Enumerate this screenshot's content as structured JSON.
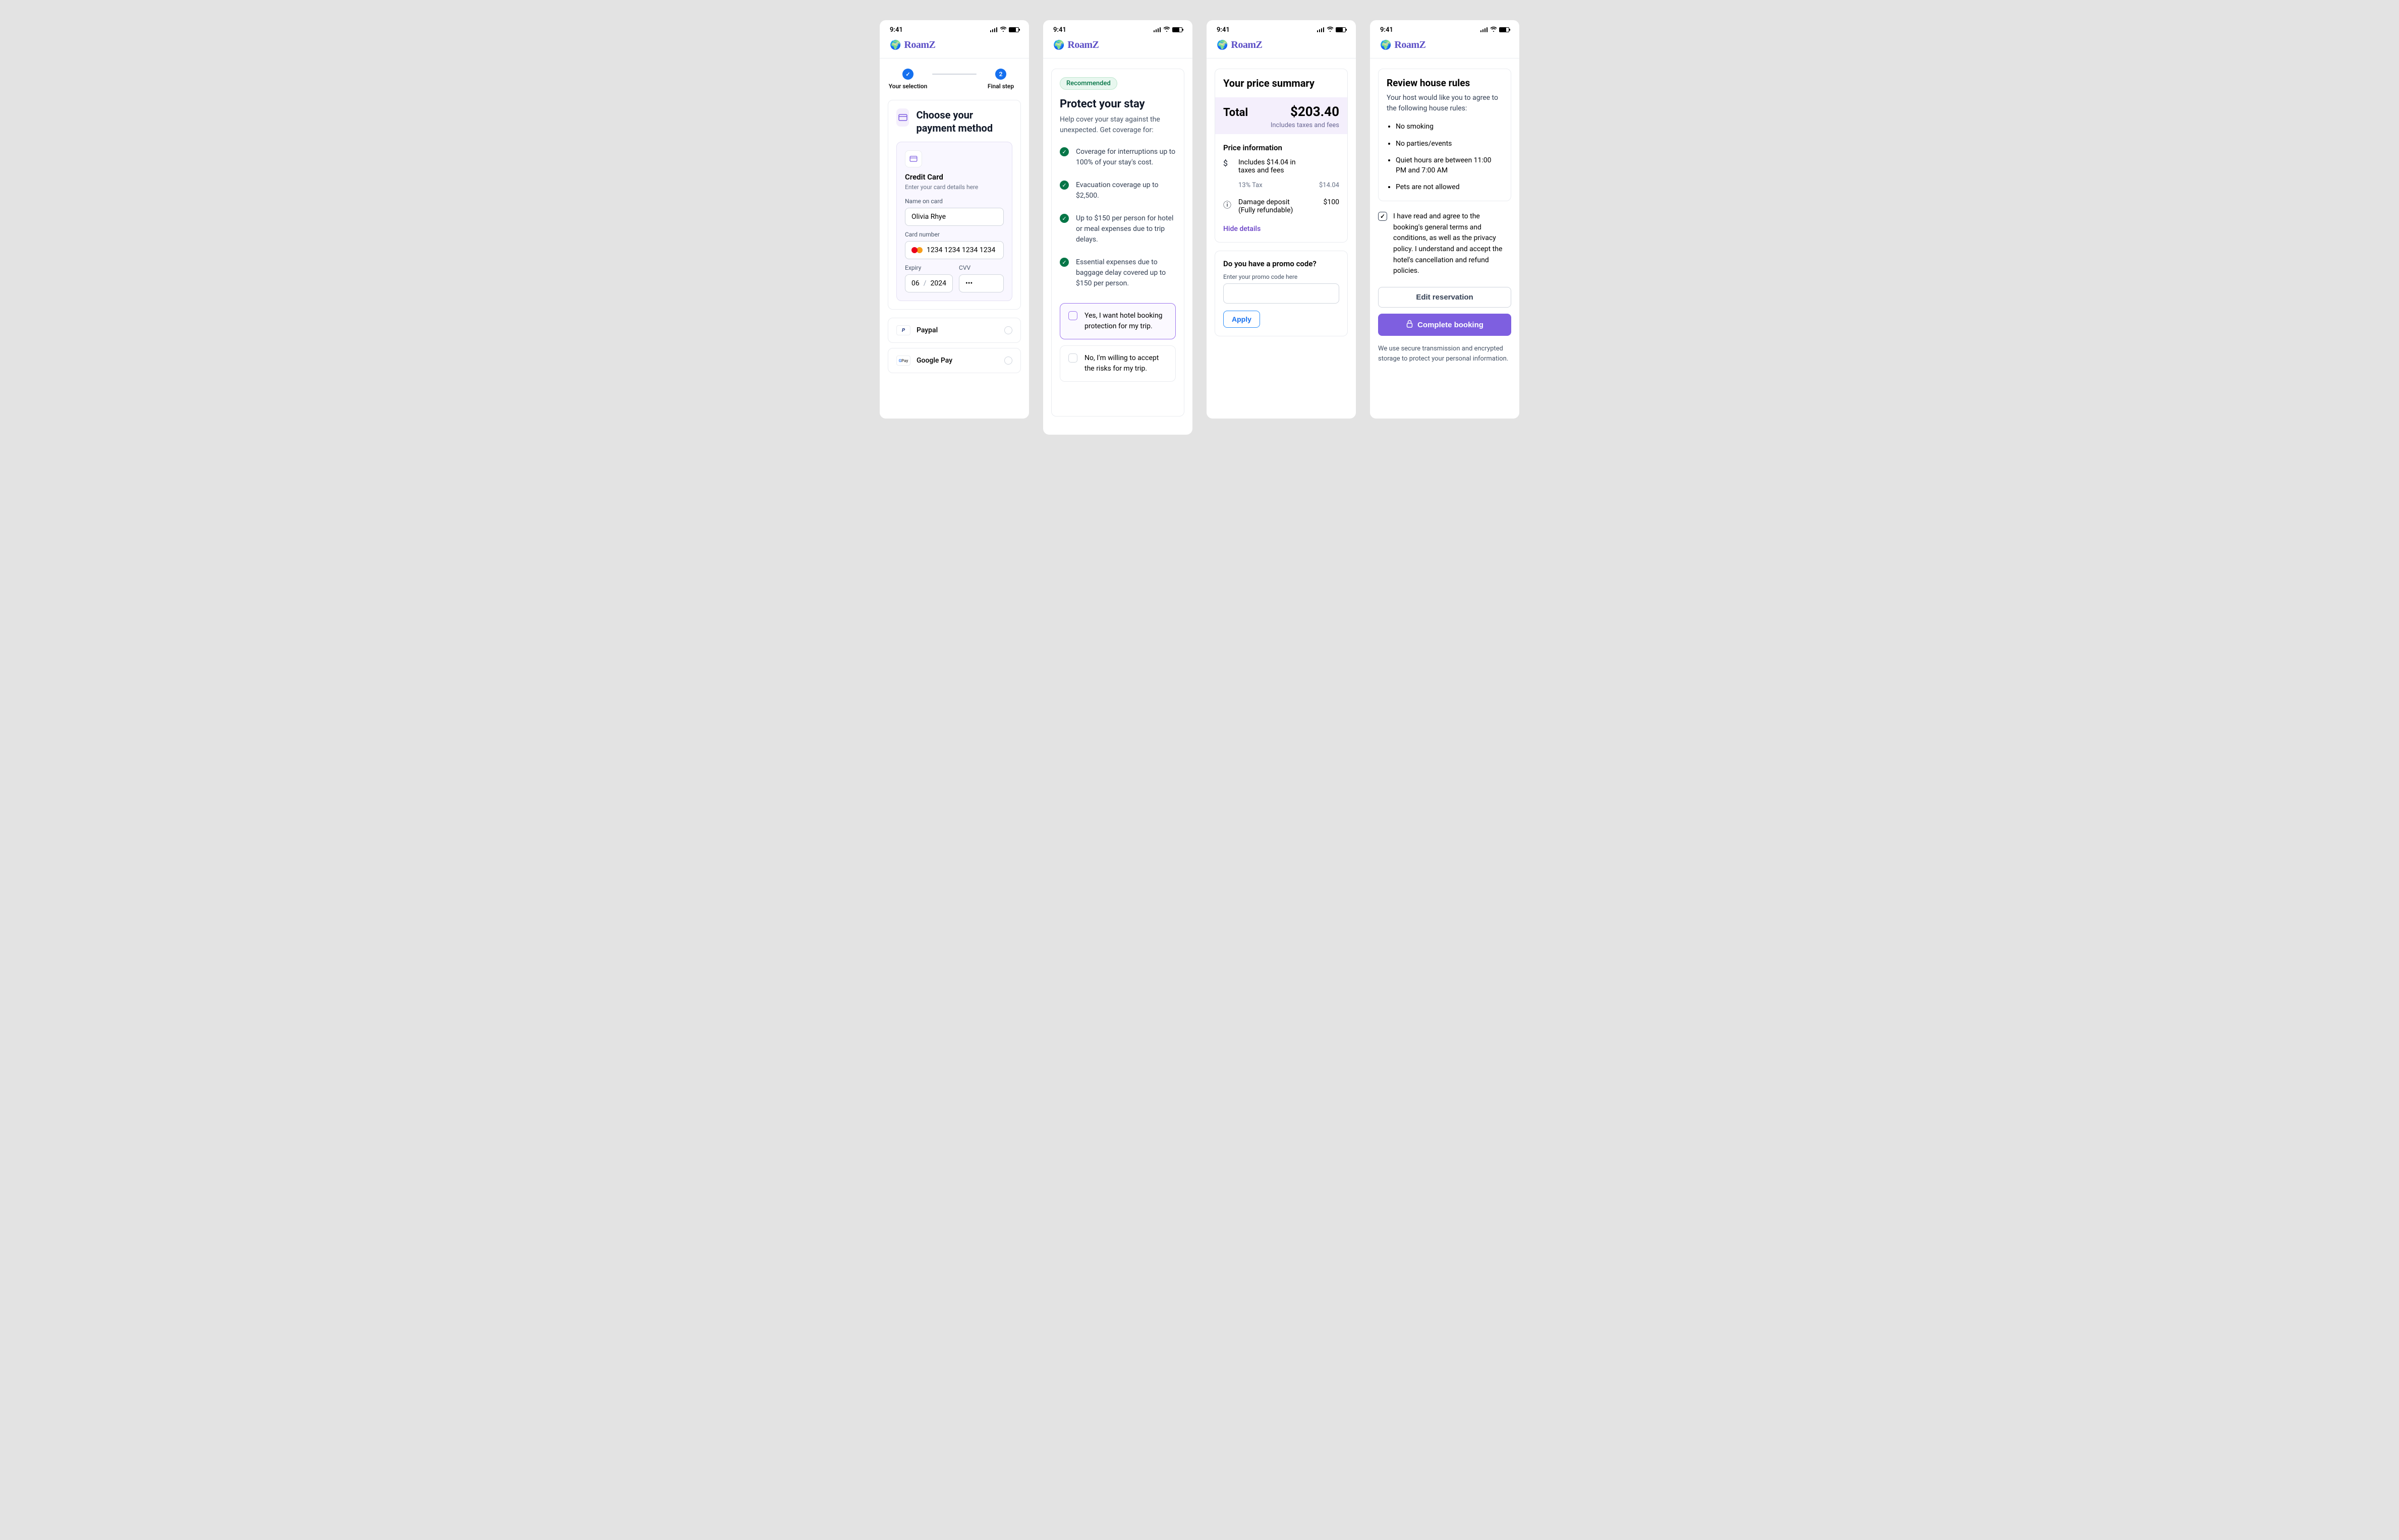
{
  "common": {
    "time": "9:41",
    "brand": "RoamZ"
  },
  "s1": {
    "step1": "Your selection",
    "step2": "Final step",
    "heading": "Choose your payment method",
    "cc": {
      "title": "Credit Card",
      "hint": "Enter your card details here",
      "name_label": "Name on card",
      "name_value": "Olivia Rhye",
      "num_label": "Card number",
      "num_value": "1234 1234 1234 1234",
      "exp_label": "Expiry",
      "exp_month": "06",
      "exp_year": "2024",
      "cvv_label": "CVV",
      "cvv_value": "•••"
    },
    "paypal": "Paypal",
    "gpay": "Google Pay"
  },
  "s2": {
    "badge": "Recommended",
    "heading": "Protect your stay",
    "sub": "Help cover your stay against the unexpected. Get coverage for:",
    "items": [
      "Coverage for interruptions up to 100% of your stay's cost.",
      "Evacuation coverage up to $2,500.",
      "Up to $150 per person for hotel or meal expenses due to trip delays.",
      "Essential expenses due to baggage delay covered up to $150 per person."
    ],
    "opt_yes": "Yes, I want hotel booking protection for my trip.",
    "opt_no": "No, I'm willing to accept the risks for my trip."
  },
  "s3": {
    "summary_h": "Your price summary",
    "total_label": "Total",
    "total_amount": "$203.40",
    "total_note": "Includes taxes and fees",
    "price_info_h": "Price information",
    "includes": "Includes $14.04 in taxes and fees",
    "tax_label": "13% Tax",
    "tax_amount": "$14.04",
    "deposit_label": "Damage deposit (Fully refundable)",
    "deposit_amount": "$100",
    "hide": "Hide details",
    "promo_h": "Do you have a promo code?",
    "promo_label": "Enter your promo code here",
    "apply": "Apply"
  },
  "s4": {
    "heading": "Review house rules",
    "sub": "Your host would like you to agree to the following house rules:",
    "rules": [
      "No smoking",
      "No parties/events",
      "Quiet hours are between 11:00 PM and 7:00 AM",
      "Pets are not allowed"
    ],
    "agree": "I have read and agree to the booking's general terms and conditions, as well as the privacy policy. I understand and accept the hotel's cancellation and refund policies.",
    "edit": "Edit reservation",
    "complete": "Complete booking",
    "footnote": "We use secure transmission and encrypted storage to protect your personal information."
  }
}
